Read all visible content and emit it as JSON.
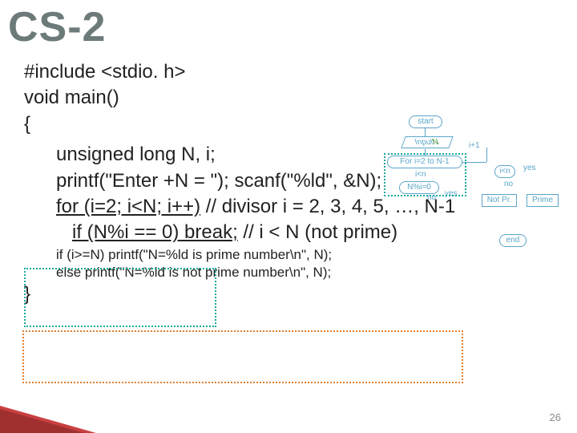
{
  "title": "CS-2",
  "code": {
    "l1": "#include <stdio. h>",
    "l2": "void main()",
    "l3": "{",
    "l4": "unsigned long N, i;",
    "l5a": "printf(\"Enter +N = \"); scanf(\"%ld\", &N);",
    "l6a": "for (i=2; i<N; i++)",
    "l6b": " // divisor i = 2, 3, 4, 5, …, N-1",
    "l7a": "if (N%i == 0) break;",
    "l7b": " // i < N (not prime)",
    "l8": "if (i>=N) printf(\"N=%ld is prime number\\n\", N);",
    "l9": "else printf(\"N=%ld is not prime number\\n\", N);",
    "l10": "}"
  },
  "flow": {
    "start": "start",
    "input_a": "Input ",
    "input_b": "N",
    "loop": "For i=2 to N-1",
    "inc": "i+1",
    "d1": "i<n",
    "d2": "N%i=0",
    "d3": "i<n",
    "no": "no",
    "yes": "yes",
    "notpr": "Not Pr.",
    "prime": "Prime",
    "end": "end"
  },
  "page": "26"
}
